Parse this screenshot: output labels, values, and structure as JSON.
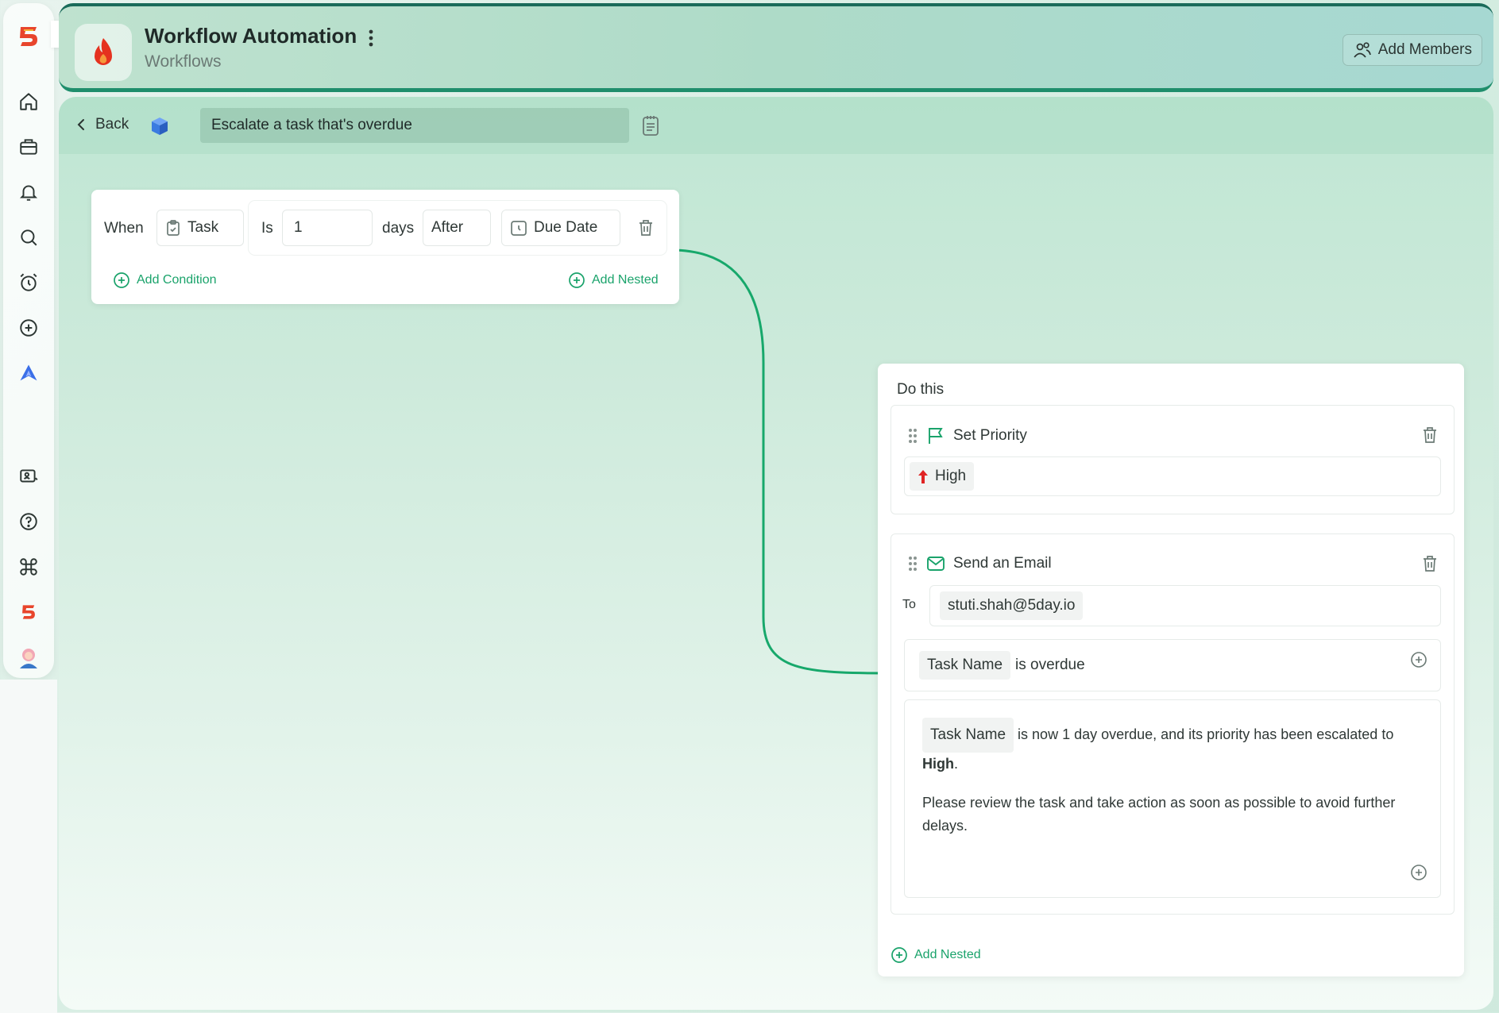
{
  "header": {
    "title": "Workflow Automation",
    "subtitle": "Workflows",
    "add_members_label": "Add Members"
  },
  "toolbar": {
    "back_label": "Back",
    "workflow_name": "Escalate a task that's overdue"
  },
  "trigger": {
    "when_label": "When",
    "entity": "Task",
    "operator": "Is",
    "days_value": "1",
    "unit": "days",
    "relation": "After",
    "field": "Due Date",
    "add_condition_label": "Add Condition",
    "add_nested_label": "Add Nested"
  },
  "actions": {
    "do_this_label": "Do this",
    "set_priority": {
      "label": "Set Priority",
      "value": "High"
    },
    "send_email": {
      "label": "Send an Email",
      "to_label": "To",
      "to_value": "stuti.shah@5day.io",
      "subject_token": "Task Name",
      "subject_text": "is overdue",
      "body_token": "Task Name",
      "body_text_1": "is now 1 day overdue, and its priority has been escalated to",
      "body_bold": "High",
      "body_period": ".",
      "body_paragraph_2": "Please review the task and take action as soon as possible to avoid further delays."
    },
    "add_nested_label": "Add Nested"
  },
  "colors": {
    "accent_green": "#1aa36b",
    "priority_high": "#e02424",
    "cube_blue": "#3b7be0"
  }
}
